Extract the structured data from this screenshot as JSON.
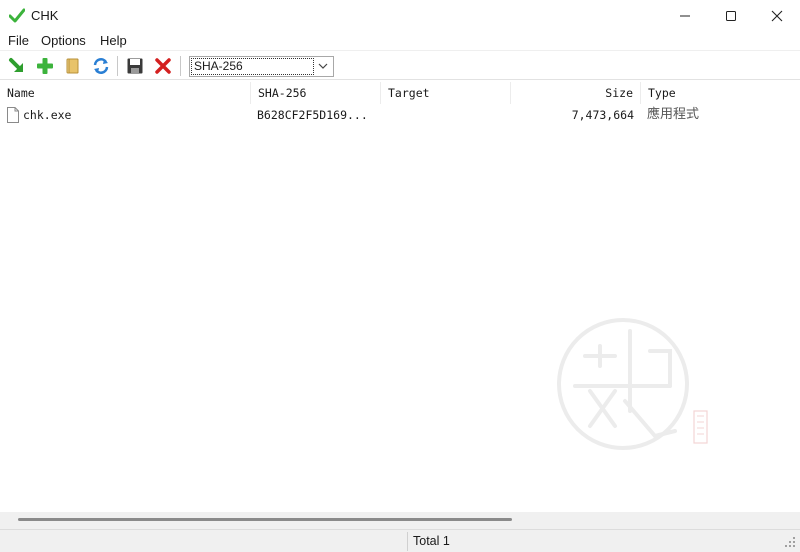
{
  "window": {
    "title": "CHK",
    "app_icon": "green-checkmark-icon",
    "controls": {
      "minimize": "minimize-icon",
      "maximize": "maximize-icon",
      "close": "close-icon"
    }
  },
  "menu": {
    "items": [
      {
        "label": "File"
      },
      {
        "label": "Options"
      },
      {
        "label": "Help"
      }
    ]
  },
  "toolbar": {
    "buttons": [
      {
        "icon": "open-arrow-icon",
        "color": "#2e9e2e"
      },
      {
        "icon": "add-icon",
        "color": "#3cb33c"
      },
      {
        "icon": "folder-icon",
        "color": "#e8c36a"
      },
      {
        "icon": "refresh-icon",
        "color": "#2a7fd4"
      },
      {
        "icon": "save-icon",
        "color": "#333333"
      },
      {
        "icon": "delete-icon",
        "color": "#d42020"
      }
    ],
    "algorithm": {
      "selected": "SHA-256"
    }
  },
  "file_list": {
    "columns": [
      "Name",
      "SHA-256",
      "Target",
      "Size",
      "Type"
    ],
    "rows": [
      {
        "name": "chk.exe",
        "sha256": "B628CF2F5D169...",
        "target": "",
        "size": "7,473,664",
        "type": "應用程式"
      }
    ]
  },
  "status": {
    "total": "Total 1"
  },
  "colors": {
    "accent_green": "#3cb33c",
    "close_red": "#d42020",
    "status_bg": "#f0f0f0"
  }
}
